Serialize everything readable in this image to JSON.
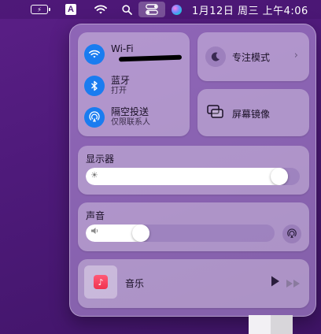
{
  "menubar": {
    "battery_icon": "battery-charging-icon",
    "input_label": "A",
    "wifi_icon": "wifi-icon",
    "search_icon": "search-icon",
    "control_center_icon": "control-center-icon",
    "siri_icon": "siri-icon",
    "clock": "1月12日 周三 上午4:06"
  },
  "connectivity": {
    "wifi": {
      "title": "Wi-Fi",
      "icon": "wifi-icon"
    },
    "bluetooth": {
      "title": "蓝牙",
      "subtitle": "打开",
      "icon": "bluetooth-icon"
    },
    "airdrop": {
      "title": "隔空投送",
      "subtitle": "仅限联系人",
      "icon": "airdrop-icon"
    }
  },
  "focus": {
    "label": "专注模式",
    "icon": "moon-icon",
    "arrow": "›"
  },
  "mirroring": {
    "label": "屏幕镜像",
    "icon": "screen-mirroring-icon"
  },
  "display": {
    "title": "显示器",
    "brightness_fraction": 0.94
  },
  "sound": {
    "title": "声音",
    "volume_fraction": 0.27
  },
  "music": {
    "label": "音乐"
  },
  "colors": {
    "accent": "#1a7cf0",
    "background": "#4e1a7a"
  }
}
